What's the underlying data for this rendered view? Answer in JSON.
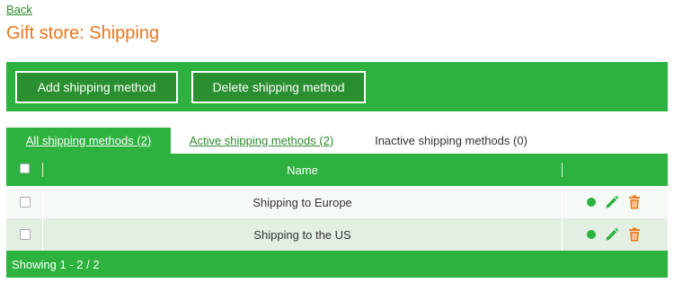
{
  "nav": {
    "back_label": "Back"
  },
  "page": {
    "title": "Gift store: Shipping"
  },
  "toolbar": {
    "add_label": "Add shipping method",
    "delete_label": "Delete shipping method"
  },
  "tabs": [
    {
      "label": "All shipping methods (2)",
      "active": true
    },
    {
      "label": "Active shipping methods (2)",
      "active": false
    },
    {
      "label": "Inactive shipping methods (0)",
      "active": false
    }
  ],
  "table": {
    "columns": [
      "",
      "Name",
      ""
    ],
    "rows": [
      {
        "name": "Shipping to Europe",
        "status": "active",
        "checked": false
      },
      {
        "name": "Shipping to the US",
        "status": "active",
        "checked": false
      }
    ],
    "footer": "Showing 1 - 2 / 2"
  },
  "colors": {
    "accent_green": "#2db23f",
    "button_green": "#2a8f30",
    "title_orange": "#e8761e",
    "delete_orange": "#f07a1a"
  },
  "icons": [
    "status-dot-icon",
    "pencil-icon",
    "trash-icon"
  ]
}
